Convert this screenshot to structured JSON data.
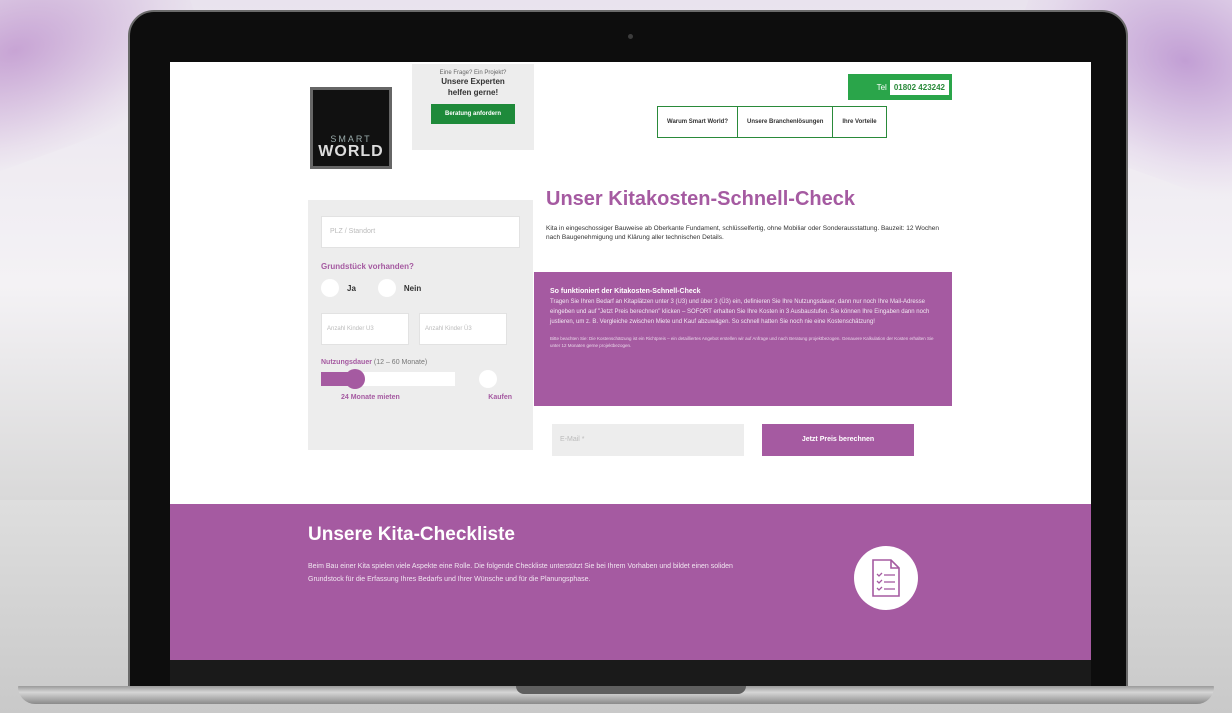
{
  "header": {
    "logo_top": "SMART",
    "logo_bottom": "WORLD",
    "cta_small": "Eine Frage? Ein Projekt?",
    "cta_line1": "Unsere Experten",
    "cta_line2": "helfen gerne!",
    "cta_button": "Beratung anfordern",
    "tel_label": "Tel",
    "tel_number": "01802 423242",
    "nav": [
      "Warum Smart World?",
      "Unsere Branchenlösungen",
      "Ihre Vorteile"
    ]
  },
  "form": {
    "location_placeholder": "PLZ / Standort",
    "plot_label": "Grundstück vorhanden?",
    "radio_yes": "Ja",
    "radio_no": "Nein",
    "kids_u3_placeholder": "Anzahl Kinder U3",
    "kids_o3_placeholder": "Anzahl Kinder Ü3",
    "duration_label": "Nutzungsdauer",
    "duration_note": "(12 – 60 Monate)",
    "duration_months": 24,
    "duration_min": 12,
    "duration_max": 60,
    "rent_label": "24 Monate mieten",
    "buy_label": "Kaufen"
  },
  "main": {
    "headline": "Unser Kitakosten-Schnell-Check",
    "intro": "Kita in eingeschossiger Bauweise ab Oberkante Fundament, schlüsselfertig, ohne Mobiliar oder Sonderausstattung. Bauzeit: 12 Wochen nach Baugenehmigung und Klärung aller technischen Details.",
    "how_title": "So funktioniert der Kitakosten-Schnell-Check",
    "how_text": "Tragen Sie Ihren Bedarf an Kitaplätzen unter 3 (U3) und über 3 (Ü3) ein, definieren Sie Ihre Nutzungsdauer, dann nur noch Ihre Mail-Adresse eingeben und auf \"Jetzt Preis berechnen\" klicken – SOFORT erhalten Sie Ihre Kosten in 3 Ausbaustufen. Sie können Ihre Eingaben dann noch justieren, um z. B. Vergleiche zwischen Miete und Kauf abzuwägen. So schnell hatten Sie noch nie eine Kostenschätzung!",
    "how_fine": "Bitte beachten Sie: Die Kostenschätzung ist ein Richtpreis – ein detailliertes Angebot erstellen wir auf Anfrage und nach Beratung projektbezogen. Genauere Kalkulation der Kosten erhalten Sie unter 12 Monaten gerne projektbezogen.",
    "email_placeholder": "E-Mail *",
    "calc_button": "Jetzt Preis berechnen"
  },
  "checklist": {
    "title": "Unsere Kita-Checkliste",
    "text": "Beim Bau einer Kita spielen viele Aspekte eine Rolle. Die folgende Checkliste unterstützt Sie bei Ihrem Vorhaben und bildet einen soliden Grundstock für die Erfassung Ihres Bedarfs und Ihrer Wünsche und für die Planungsphase.",
    "icon": "checklist-document-icon"
  },
  "colors": {
    "accent": "#a55aa1",
    "green": "#2aa54a",
    "panel": "#ededed"
  }
}
